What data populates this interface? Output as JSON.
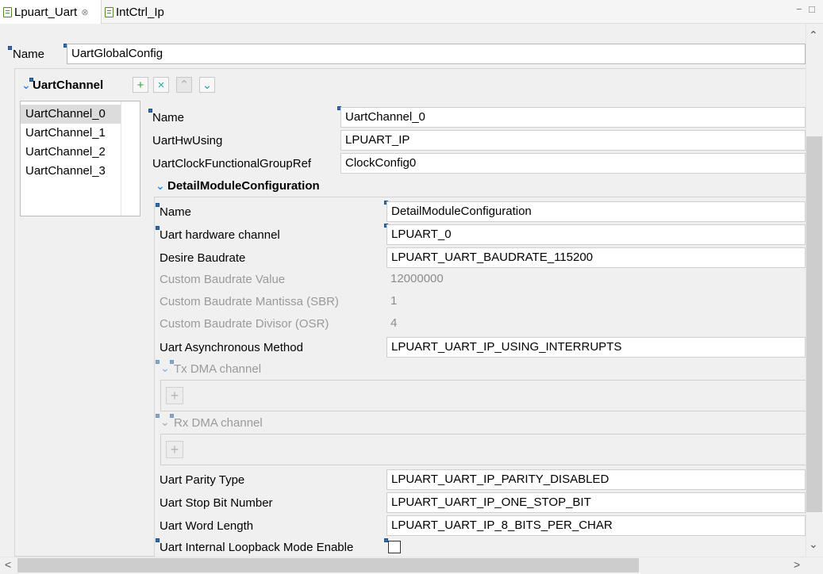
{
  "tabs": [
    {
      "label": "Lpuart_Uart",
      "close": "⊗"
    },
    {
      "label": "IntCtrl_Ip"
    }
  ],
  "window_controls": {
    "minimize": "−",
    "maximize": "□"
  },
  "top": {
    "name_label": "Name",
    "name_value": "UartGlobalConfig"
  },
  "uart_channel": {
    "title": "UartChannel",
    "toolbar": {
      "add": "+",
      "remove": "×",
      "up": "⌃",
      "down": "⌄"
    },
    "items": [
      "UartChannel_0",
      "UartChannel_1",
      "UartChannel_2",
      "UartChannel_3"
    ]
  },
  "channel_form": {
    "name_label": "Name",
    "name_value": "UartChannel_0",
    "hw_label": "UartHwUsing",
    "hw_value": "LPUART_IP",
    "clock_label": "UartClockFunctionalGroupRef",
    "clock_value": "ClockConfig0"
  },
  "detail": {
    "title": "DetailModuleConfiguration",
    "name_label": "Name",
    "name_value": "DetailModuleConfiguration",
    "hw_channel_label": "Uart hardware channel",
    "hw_channel_value": "LPUART_0",
    "baud_label": "Desire Baudrate",
    "baud_value": "LPUART_UART_BAUDRATE_115200",
    "custom_value_label": "Custom Baudrate Value",
    "custom_value_value": "12000000",
    "mantissa_label": "Custom Baudrate Mantissa (SBR)",
    "mantissa_value": "1",
    "divisor_label": "Custom Baudrate Divisor (OSR)",
    "divisor_value": "4",
    "async_label": "Uart Asynchronous Method",
    "async_value": "LPUART_UART_IP_USING_INTERRUPTS",
    "tx_dma_label": "Tx DMA channel",
    "rx_dma_label": "Rx DMA channel",
    "add_glyph": "+",
    "parity_label": "Uart Parity Type",
    "parity_value": "LPUART_UART_IP_PARITY_DISABLED",
    "stop_label": "Uart Stop Bit Number",
    "stop_value": "LPUART_UART_IP_ONE_STOP_BIT",
    "word_label": "Uart Word Length",
    "word_value": "LPUART_UART_IP_8_BITS_PER_CHAR",
    "loopback_label": "Uart Internal Loopback Mode Enable",
    "loopback_checked": false
  },
  "scroll": {
    "up": "⌃",
    "down": "⌄",
    "left": "<",
    "right": ">"
  },
  "colors": {
    "accent": "#2f8ae6",
    "required_marker": "#2f6fb3",
    "add_green": "#3b9e3b"
  }
}
